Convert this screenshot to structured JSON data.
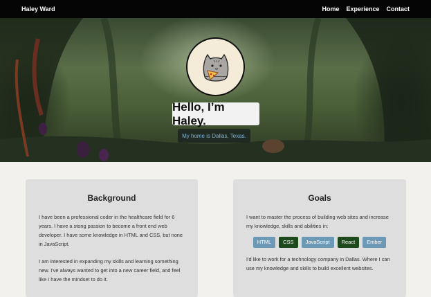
{
  "nav": {
    "brand": "Haley Ward",
    "links": [
      "Home",
      "Experience",
      "Contact"
    ]
  },
  "hero": {
    "avatar_icon": "pusheen-cat-pizza-icon",
    "title": "Hello, I’m Haley.",
    "subtitle": "My home is Dallas, Texas."
  },
  "background": {
    "heading": "Background",
    "paragraphs": [
      "I have been a professional coder in the healthcare field for 6 years. I have a stong passion to become a front end web developer. I have some knowledge in HTML and CSS, but none in JavaScript.",
      "I am interested in expanding my skills and learning something new. I've always wanted to get into a new career field, and feel like I have the mindset to do it."
    ]
  },
  "goals": {
    "heading": "Goals",
    "intro": "I want to master the process of building web sites and increase my knowledge, skills and abilities in:",
    "skills": [
      {
        "label": "HTML",
        "color": "#6c9ab6"
      },
      {
        "label": "CSS",
        "color": "#1d4a1d"
      },
      {
        "label": "JavaScript",
        "color": "#6c9ab6"
      },
      {
        "label": "React",
        "color": "#1d4a1d"
      },
      {
        "label": "Ember",
        "color": "#6c9ab6"
      }
    ],
    "outro": "I'd like to work for a technology company in Dallas. Where I can use my knowledge and skills to build excellent websites."
  }
}
